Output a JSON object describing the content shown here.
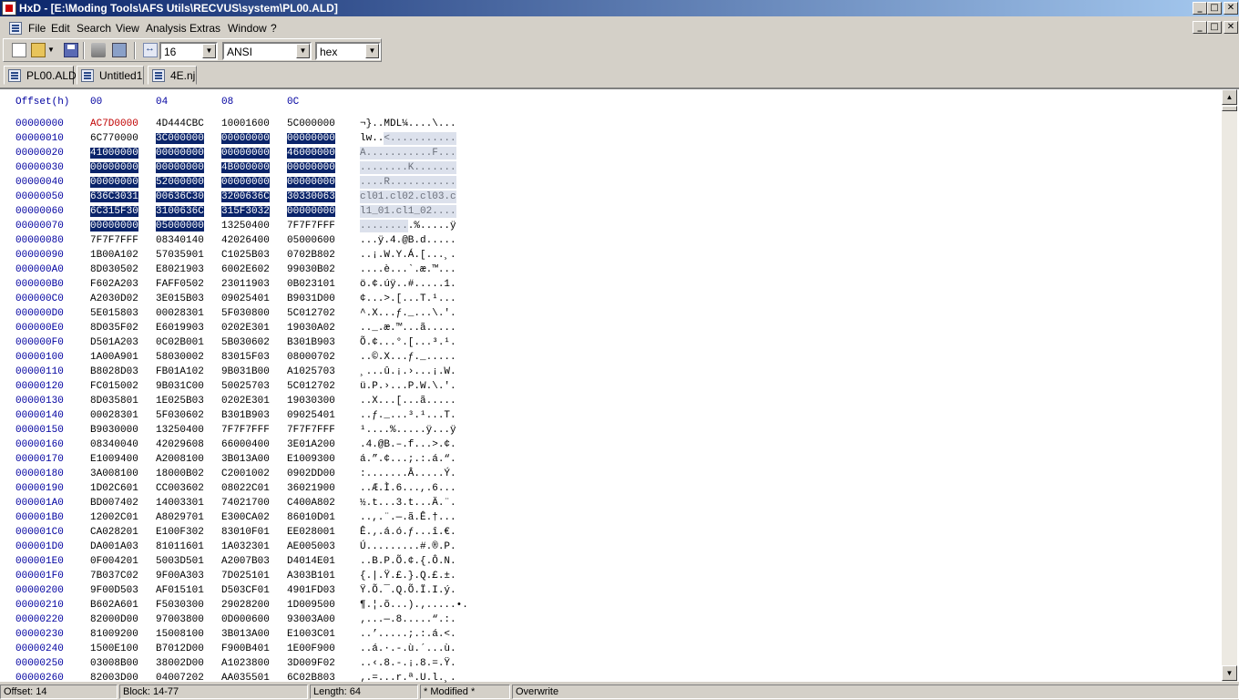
{
  "window": {
    "title": "HxD - [E:\\Moding Tools\\AFS Utils\\RECVUS\\system\\PL00.ALD]",
    "controls": [
      "_",
      "□",
      "✕"
    ]
  },
  "menu": [
    "File",
    "Edit",
    "Search",
    "View",
    "Analysis",
    "Extras",
    "Window",
    "?"
  ],
  "toolbar": {
    "bytes_per_row": "16",
    "charset": "ANSI",
    "offset_base": "hex"
  },
  "tabs": [
    {
      "label": "PL00.ALD",
      "active": true
    },
    {
      "label": "Untitled1",
      "active": false
    },
    {
      "label": "4E.nj",
      "active": false
    }
  ],
  "editor": {
    "offset_header": "Offset(h)",
    "column_headers": [
      "00",
      "04",
      "08",
      "0C"
    ],
    "rows": [
      {
        "offset": "00000000",
        "hex": [
          "AC7D0000",
          "4D444CBC",
          "10001600",
          "5C000000"
        ],
        "ascii": "¬}..MDL¼....\\..."
      },
      {
        "offset": "00000010",
        "hex": [
          "6C770000",
          "3C000000",
          "00000000",
          "00000000"
        ],
        "ascii": "lw..<..........."
      },
      {
        "offset": "00000020",
        "hex": [
          "41000000",
          "00000000",
          "00000000",
          "46000000"
        ],
        "ascii": "A...........F..."
      },
      {
        "offset": "00000030",
        "hex": [
          "00000000",
          "00000000",
          "4B000000",
          "00000000"
        ],
        "ascii": "........K......."
      },
      {
        "offset": "00000040",
        "hex": [
          "00000000",
          "52000000",
          "00000000",
          "00000000"
        ],
        "ascii": "....R..........."
      },
      {
        "offset": "00000050",
        "hex": [
          "636C3031",
          "00636C30",
          "3200636C",
          "30330063"
        ],
        "ascii": "cl01.cl02.cl03.c"
      },
      {
        "offset": "00000060",
        "hex": [
          "6C315F30",
          "3100636C",
          "315F3032",
          "00000000"
        ],
        "ascii": "l1_01.cl1_02...."
      },
      {
        "offset": "00000070",
        "hex": [
          "00000000",
          "05000000",
          "13250400",
          "7F7F7FFF"
        ],
        "ascii": ".........%.....ÿ"
      },
      {
        "offset": "00000080",
        "hex": [
          "7F7F7FFF",
          "08340140",
          "42026400",
          "05000600"
        ],
        "ascii": "...ÿ.4.@B.d....."
      },
      {
        "offset": "00000090",
        "hex": [
          "1B00A102",
          "57035901",
          "C1025B03",
          "0702B802"
        ],
        "ascii": "..¡.W.Y.Á.[...¸."
      },
      {
        "offset": "000000A0",
        "hex": [
          "8D030502",
          "E8021903",
          "6002E602",
          "99030B02"
        ],
        "ascii": "....è...`.æ.™..."
      },
      {
        "offset": "000000B0",
        "hex": [
          "F602A203",
          "FAFF0502",
          "23011903",
          "0B023101"
        ],
        "ascii": "ö.¢.úÿ..#.....1."
      },
      {
        "offset": "000000C0",
        "hex": [
          "A2030D02",
          "3E015B03",
          "09025401",
          "B9031D00"
        ],
        "ascii": "¢...>.[...T.¹..."
      },
      {
        "offset": "000000D0",
        "hex": [
          "5E015803",
          "00028301",
          "5F030800",
          "5C012702"
        ],
        "ascii": "^.X...ƒ._...\\.'."
      },
      {
        "offset": "000000E0",
        "hex": [
          "8D035F02",
          "E6019903",
          "0202E301",
          "19030A02"
        ],
        "ascii": ".._.æ.™...ã....."
      },
      {
        "offset": "000000F0",
        "hex": [
          "D501A203",
          "0C02B001",
          "5B030602",
          "B301B903"
        ],
        "ascii": "Õ.¢...°.[...³.¹."
      },
      {
        "offset": "00000100",
        "hex": [
          "1A00A901",
          "58030002",
          "83015F03",
          "08000702"
        ],
        "ascii": "..©.X...ƒ._....."
      },
      {
        "offset": "00000110",
        "hex": [
          "B8028D03",
          "FB01A102",
          "9B031B00",
          "A1025703"
        ],
        "ascii": "¸...û.¡.›...¡.W."
      },
      {
        "offset": "00000120",
        "hex": [
          "FC015002",
          "9B031C00",
          "50025703",
          "5C012702"
        ],
        "ascii": "ü.P.›...P.W.\\.'."
      },
      {
        "offset": "00000130",
        "hex": [
          "8D035801",
          "1E025B03",
          "0202E301",
          "19030300"
        ],
        "ascii": "..X...[...ã....."
      },
      {
        "offset": "00000140",
        "hex": [
          "00028301",
          "5F030602",
          "B301B903",
          "09025401"
        ],
        "ascii": "..ƒ._...³.¹...T."
      },
      {
        "offset": "00000150",
        "hex": [
          "B9030000",
          "13250400",
          "7F7F7FFF",
          "7F7F7FFF"
        ],
        "ascii": "¹....%.....ÿ...ÿ"
      },
      {
        "offset": "00000160",
        "hex": [
          "08340040",
          "42029608",
          "66000400",
          "3E01A200"
        ],
        "ascii": ".4.@B.–.f...>.¢."
      },
      {
        "offset": "00000170",
        "hex": [
          "E1009400",
          "A2008100",
          "3B013A00",
          "E1009300"
        ],
        "ascii": "á.”.¢...;.:.á.“."
      },
      {
        "offset": "00000180",
        "hex": [
          "3A008100",
          "18000B02",
          "C2001002",
          "0902DD00"
        ],
        "ascii": ":.......Â.....Ý."
      },
      {
        "offset": "00000190",
        "hex": [
          "1D02C601",
          "CC003602",
          "08022C01",
          "36021900"
        ],
        "ascii": "..Æ.Ì.6...,.6..."
      },
      {
        "offset": "000001A0",
        "hex": [
          "BD007402",
          "14003301",
          "74021700",
          "C400A802"
        ],
        "ascii": "½.t...3.t...Ä.¨."
      },
      {
        "offset": "000001B0",
        "hex": [
          "12002C01",
          "A8029701",
          "E300CA02",
          "86010D01"
        ],
        "ascii": "..,.¨.—.ã.Ê.†..."
      },
      {
        "offset": "000001C0",
        "hex": [
          "CA028201",
          "E100F302",
          "83010F01",
          "EE028001"
        ],
        "ascii": "Ê.‚.á.ó.ƒ...î.€."
      },
      {
        "offset": "000001D0",
        "hex": [
          "DA001A03",
          "81011601",
          "1A032301",
          "AE005003"
        ],
        "ascii": "Ú.........#.®.P."
      },
      {
        "offset": "000001E0",
        "hex": [
          "0F004201",
          "5003D501",
          "A2007B03",
          "D4014E01"
        ],
        "ascii": "..B.P.Õ.¢.{.Ô.N."
      },
      {
        "offset": "000001F0",
        "hex": [
          "7B037C02",
          "9F00A303",
          "7D025101",
          "A303B101"
        ],
        "ascii": "{.|.Ÿ.£.}.Q.£.±."
      },
      {
        "offset": "00000200",
        "hex": [
          "9F00D503",
          "AF015101",
          "D503CF01",
          "4901FD03"
        ],
        "ascii": "Ÿ.Õ.¯.Q.Õ.Ï.I.ý."
      },
      {
        "offset": "00000210",
        "hex": [
          "B602A601",
          "F5030300",
          "29028200",
          "1D009500"
        ],
        "ascii": "¶.¦.õ...).‚.....•."
      },
      {
        "offset": "00000220",
        "hex": [
          "82000D00",
          "97003800",
          "0D000600",
          "93003A00"
        ],
        "ascii": "‚...—.8.....“.:."
      },
      {
        "offset": "00000230",
        "hex": [
          "81009200",
          "15008100",
          "3B013A00",
          "E1003C01"
        ],
        "ascii": "..’.....;.:.á.<."
      },
      {
        "offset": "00000240",
        "hex": [
          "1500E100",
          "B7012D00",
          "F900B401",
          "1E00F900"
        ],
        "ascii": "..á.·.-.ù.´...ù."
      },
      {
        "offset": "00000250",
        "hex": [
          "03008B00",
          "38002D00",
          "A1023800",
          "3D009F02"
        ],
        "ascii": "..‹.8.-.¡.8.=.Ÿ."
      },
      {
        "offset": "00000260",
        "hex": [
          "82003D00",
          "04007202",
          "AA035501",
          "6C02B803"
        ],
        "ascii": "‚.=...r.ª.U.l.¸."
      }
    ]
  },
  "status": {
    "offset": "Offset: 14",
    "block": "Block: 14-77",
    "length": "Length: 64",
    "modified": "* Modified *",
    "mode": "Overwrite"
  },
  "colors": {
    "selection": "#0a246a",
    "ascii_selection": "#c0c8dc",
    "offset_text": "#0000a0",
    "cursor_text": "#c00000"
  }
}
